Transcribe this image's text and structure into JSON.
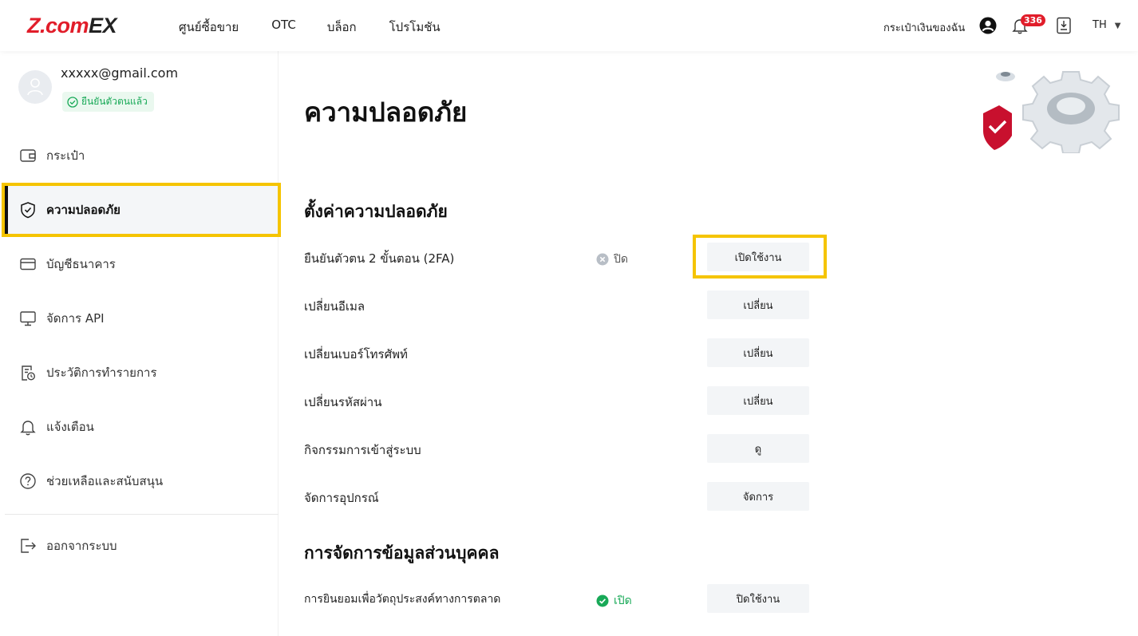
{
  "header": {
    "logo_main": "Z.com",
    "logo_suffix": "EX",
    "nav": [
      "ศูนย์ซื้อขาย",
      "OTC",
      "บล็อก",
      "โปรโมชัน"
    ],
    "wallet_link": "กระเป๋าเงินของฉัน",
    "notification_count": "336",
    "language": "TH"
  },
  "sidebar": {
    "email": "xxxxx@gmail.com",
    "verified_label": "ยืนยันตัวตนแล้ว",
    "items": [
      {
        "label": "กระเป๋า",
        "icon": "wallet-icon"
      },
      {
        "label": "ความปลอดภัย",
        "icon": "shield-check-icon"
      },
      {
        "label": "บัญชีธนาคาร",
        "icon": "bank-card-icon"
      },
      {
        "label": "จัดการ API",
        "icon": "monitor-icon"
      },
      {
        "label": "ประวัติการทำรายการ",
        "icon": "history-icon"
      },
      {
        "label": "แจ้งเตือน",
        "icon": "bell-icon"
      },
      {
        "label": "ช่วยเหลือและสนับสนุน",
        "icon": "help-icon"
      }
    ],
    "logout_label": "ออกจากระบบ"
  },
  "main": {
    "title": "ความปลอดภัย",
    "security_section": {
      "title": "ตั้งค่าความปลอดภัย",
      "rows": [
        {
          "label": "ยืนยันตัวตน 2 ขั้นตอน (2FA)",
          "status": "ปิด",
          "action": "เปิดใช้งาน"
        },
        {
          "label": "เปลี่ยนอีเมล",
          "action": "เปลี่ยน"
        },
        {
          "label": "เปลี่ยนเบอร์โทรศัพท์",
          "action": "เปลี่ยน"
        },
        {
          "label": "เปลี่ยนรหัสผ่าน",
          "action": "เปลี่ยน"
        },
        {
          "label": "กิจกรรมการเข้าสู่ระบบ",
          "action": "ดู"
        },
        {
          "label": "จัดการอุปกรณ์",
          "action": "จัดการ"
        }
      ]
    },
    "privacy_section": {
      "title": "การจัดการข้อมูลส่วนบุคคล",
      "rows": [
        {
          "label": "การยินยอมเพื่อวัตถุประสงค์ทางการตลาด",
          "status": "เปิด",
          "action": "ปิดใช้งาน"
        }
      ]
    }
  },
  "colors": {
    "brand_red": "#e11d2a",
    "highlight_yellow": "#f5c400",
    "success_green": "#18a957"
  }
}
